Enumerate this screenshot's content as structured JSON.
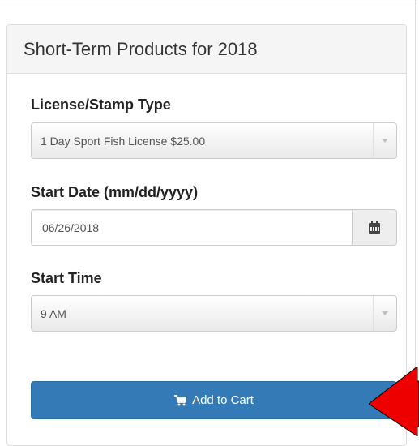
{
  "panel": {
    "title": "Short-Term Products for 2018"
  },
  "license_type": {
    "label": "License/Stamp Type",
    "selected": "1 Day Sport Fish License $25.00"
  },
  "start_date": {
    "label": "Start Date (mm/dd/yyyy)",
    "value": "06/26/2018",
    "calendar_icon": "calendar-icon"
  },
  "start_time": {
    "label": "Start Time",
    "selected": "9 AM"
  },
  "cart_button": {
    "label": "Add to Cart",
    "icon": "shopping-cart-icon"
  },
  "colors": {
    "primary": "#337ab7",
    "annotation_arrow": "#ee0000"
  }
}
